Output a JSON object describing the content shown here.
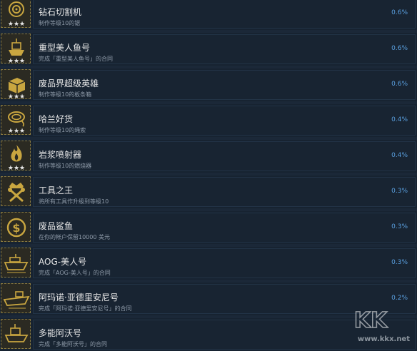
{
  "achievements": [
    {
      "title": "钻石切割机",
      "desc": "制作等级10的锯",
      "pct": "0.6%",
      "icon": "diamond-saw-icon"
    },
    {
      "title": "重型美人鱼号",
      "desc": "完成「重型美人鱼号」的合同",
      "pct": "0.6%",
      "icon": "mermaid-ship-icon"
    },
    {
      "title": "废品界超级英雄",
      "desc": "制作等级10的板条箱",
      "pct": "0.6%",
      "icon": "crate-icon"
    },
    {
      "title": "哈兰好货",
      "desc": "制作等级10的绳索",
      "pct": "0.4%",
      "icon": "rope-icon"
    },
    {
      "title": "岩浆喷射器",
      "desc": "制作等级10的燃烧器",
      "pct": "0.4%",
      "icon": "flame-icon"
    },
    {
      "title": "工具之王",
      "desc": "将所有工具作升级到等级10",
      "pct": "0.3%",
      "icon": "crown-tools-icon"
    },
    {
      "title": "废品鲨鱼",
      "desc": "在你的帐户保留10000 美元",
      "pct": "0.3%",
      "icon": "dollar-coin-icon"
    },
    {
      "title": "AOG-美人号",
      "desc": "完成「AOG-美人号」的合同",
      "pct": "0.3%",
      "icon": "ship-icon"
    },
    {
      "title": "阿玛诺·亚德里安尼号",
      "desc": "完成「阿玛诺·亚德里安尼号」的合同",
      "pct": "0.2%",
      "icon": "ship-icon"
    },
    {
      "title": "多能阿沃号",
      "desc": "完成「多能阿沃号」的合同",
      "pct": "",
      "icon": "ship-icon"
    }
  ],
  "watermark": {
    "text": "www.kkx.net"
  },
  "colors": {
    "background": "#1b2838",
    "gold": "#c9a640",
    "percent": "#5aa0e0"
  }
}
